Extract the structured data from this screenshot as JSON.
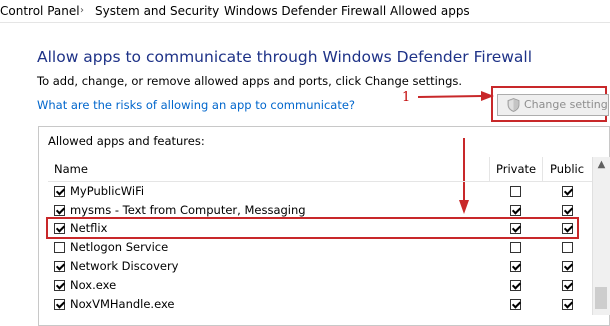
{
  "breadcrumb": {
    "items": [
      "Control Panel",
      "System and Security",
      "Windows Defender Firewall",
      "Allowed apps"
    ],
    "separator": "›"
  },
  "page": {
    "heading": "Allow apps to communicate through Windows Defender Firewall",
    "subtext": "To add, change, or remove allowed apps and ports, click Change settings.",
    "risk_link": "What are the risks of allowing an app to communicate?",
    "change_settings_label": "Change settings",
    "annotation_number": "1"
  },
  "apps_panel": {
    "title": "Allowed apps and features:",
    "columns": {
      "name": "Name",
      "private": "Private",
      "public": "Public"
    },
    "rows": [
      {
        "name": "MyPublicWiFi",
        "enabled": true,
        "private": false,
        "public": true
      },
      {
        "name": "mysms - Text from Computer, Messaging",
        "enabled": true,
        "private": true,
        "public": true
      },
      {
        "name": "Netflix",
        "enabled": true,
        "private": true,
        "public": true
      },
      {
        "name": "Netlogon Service",
        "enabled": false,
        "private": false,
        "public": false
      },
      {
        "name": "Network Discovery",
        "enabled": true,
        "private": true,
        "public": true
      },
      {
        "name": "Nox.exe",
        "enabled": true,
        "private": true,
        "public": true
      },
      {
        "name": "NoxVMHandle.exe",
        "enabled": true,
        "private": true,
        "public": true
      }
    ]
  },
  "colors": {
    "heading": "#1e3287",
    "link": "#0066cc",
    "annotation": "#c8282a"
  },
  "icons": {
    "shield": "shield-icon",
    "arrow": "arrow-icon"
  }
}
